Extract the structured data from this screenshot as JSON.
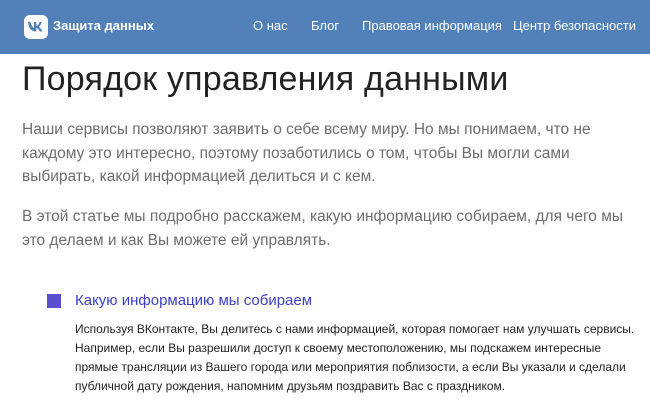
{
  "header": {
    "logo_text": "VK",
    "site_title": "Защита данных",
    "nav": [
      {
        "label": "О нас"
      },
      {
        "label": "Блог"
      },
      {
        "label": "Правовая информация"
      },
      {
        "label": "Центр безопасности"
      }
    ]
  },
  "main": {
    "title": "Порядок управления данными",
    "intro_paragraphs": [
      "Наши сервисы позволяют заявить о себе всему миру. Но мы понимаем, что не каждому это интересно, поэтому позаботились о том, чтобы Вы могли сами выбирать, какой информацией делиться и с кем.",
      "В этой статье мы подробно расскажем, какую информацию собираем, для чего мы это делаем и как Вы можете ей управлять."
    ],
    "section": {
      "title": "Какую информацию мы собираем",
      "body": "Используя ВКонтакте, Вы делитесь с нами информацией, которая помогает нам улучшать сервисы. Например, если Вы разрешили доступ к своему местоположению, мы подскажем интересные прямые трансляции из Вашего города или мероприятия поблизости, а если Вы указали и сделали публичной дату рождения, напомним друзьям поздравить Вас с праздником."
    }
  },
  "colors": {
    "header_bg": "#5181b8",
    "accent": "#5b4ecf",
    "section_title": "#3a3fc4"
  }
}
